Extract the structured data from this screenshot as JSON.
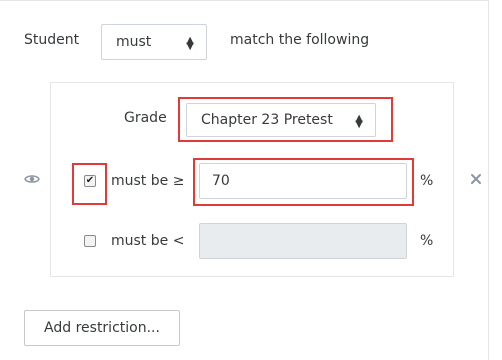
{
  "header": {
    "student_label": "Student",
    "must_select_value": "must",
    "match_text": "match the following"
  },
  "condition": {
    "grade_label": "Grade",
    "grade_select_value": "Chapter 23 Pretest",
    "min": {
      "checked": true,
      "label": "must be ≥",
      "value": "70",
      "unit": "%"
    },
    "max": {
      "checked": false,
      "label": "must be <",
      "value": "",
      "unit": "%"
    }
  },
  "actions": {
    "add_restriction_label": "Add restriction..."
  },
  "colors": {
    "highlight": "#e03a3a",
    "disabled_input_bg": "#e9ecef"
  },
  "icons": {
    "visibility": "eye-icon",
    "delete": "close-icon"
  }
}
